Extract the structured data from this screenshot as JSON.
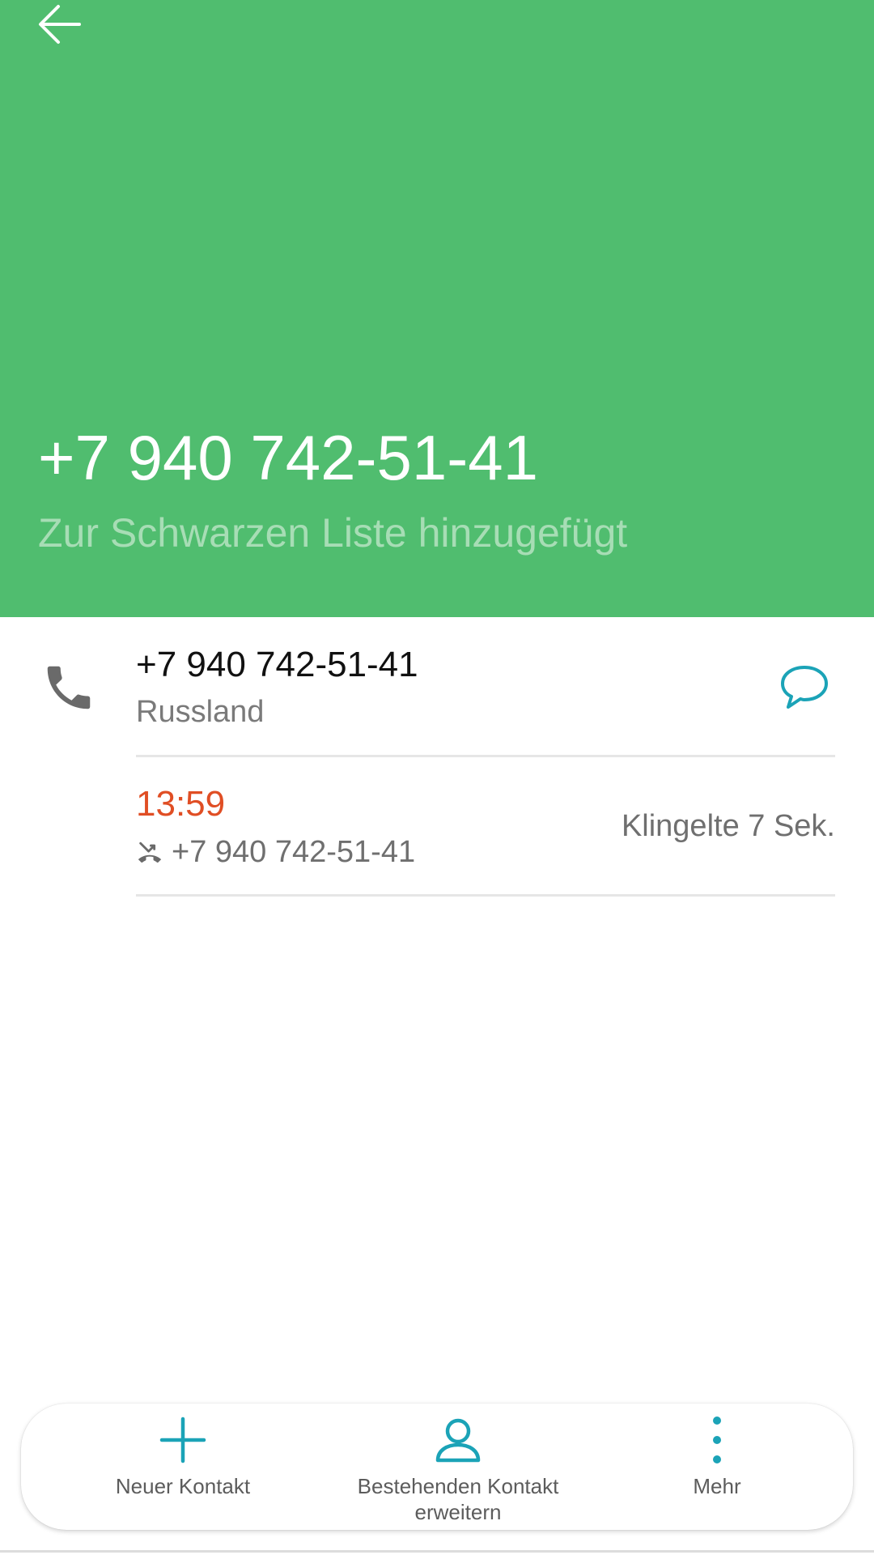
{
  "header": {
    "back_icon": "arrow-left-icon",
    "title": "+7 940 742-51-41",
    "status": "Zur Schwarzen Liste hinzugefügt",
    "background_color": "#50BD6F"
  },
  "number_row": {
    "icon": "phone-icon",
    "number": "+7 940 742-51-41",
    "country": "Russland",
    "message_icon": "message-bubble-icon"
  },
  "call_log": [
    {
      "time": "13:59",
      "type_icon": "missed-call-icon",
      "number": "+7 940 742-51-41",
      "duration": "Klingelte 7 Sek.",
      "time_color": "#E04E24"
    }
  ],
  "bottom_bar": {
    "accent_color": "#1BA3B7",
    "actions": [
      {
        "label": "Neuer Kontakt",
        "icon": "plus-icon"
      },
      {
        "label": "Bestehenden Kontakt erweitern",
        "icon": "person-icon"
      },
      {
        "label": "Mehr",
        "icon": "more-vertical-icon"
      }
    ]
  }
}
